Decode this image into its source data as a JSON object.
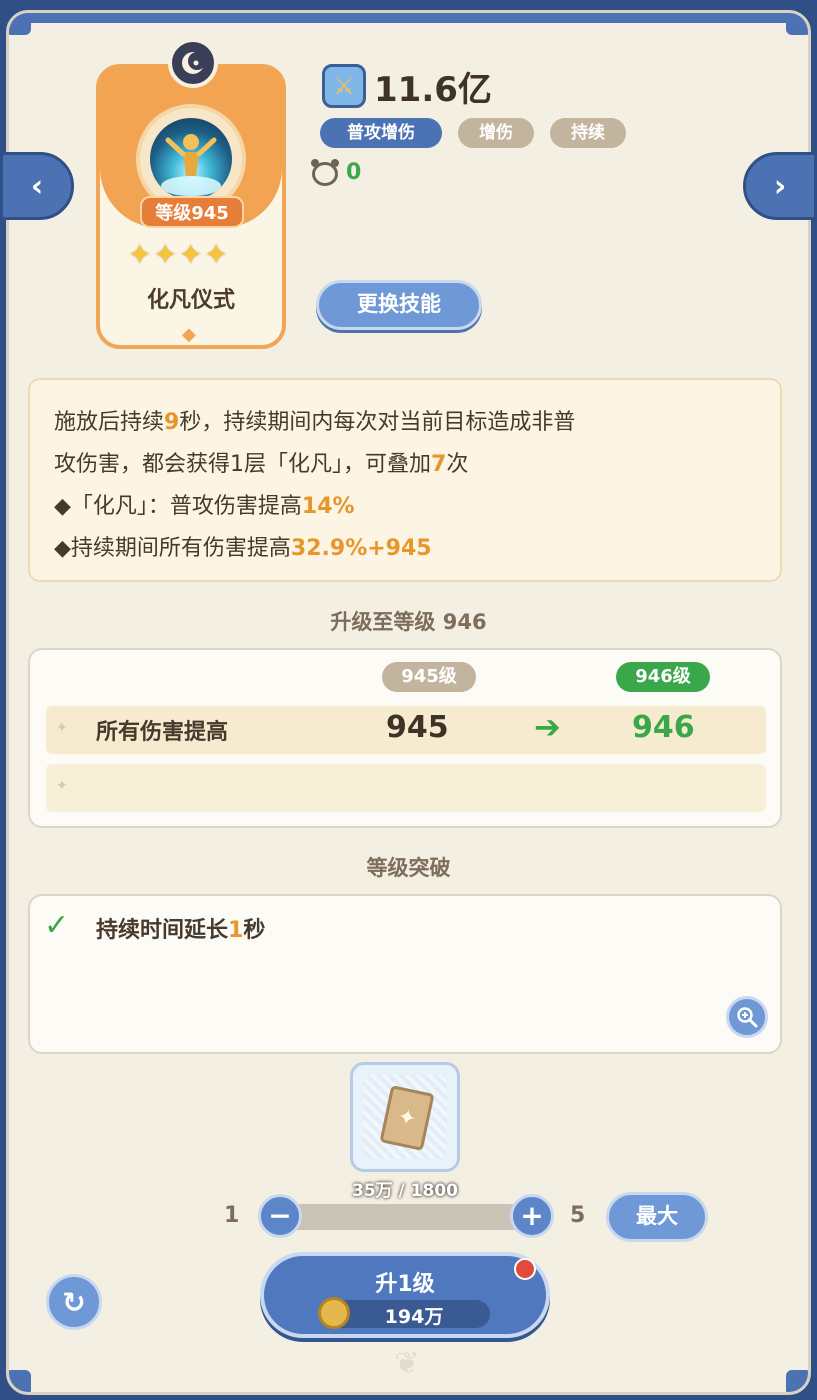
{
  "skill": {
    "level_badge": "等级945",
    "stars": [
      "✦",
      "✦",
      "✦",
      "✦"
    ],
    "name": "化凡仪式"
  },
  "stats": {
    "power": "11.6亿",
    "tags": [
      "普攻增伤",
      "增伤",
      "持续"
    ],
    "cooldown": "0"
  },
  "buttons": {
    "change_skill": "更换技能",
    "max": "最大",
    "upgrade": "升1级"
  },
  "description": {
    "line1_a": "施放后持续",
    "line1_hl": "9",
    "line1_b": "秒，持续期间内每次对当前目标造成非普",
    "line2_a": "攻伤害，都会获得1层「化凡」，可叠加",
    "line2_hl": "7",
    "line2_b": "次",
    "line3_a": "◆「化凡」：普攻伤害提高",
    "line3_hl": "14%",
    "line4_a": "◆持续期间所有伤害提高",
    "line4_hl": "32.9%+945"
  },
  "upgrade": {
    "title": "升级至等级 946",
    "current_label": "945级",
    "next_label": "946级",
    "rows": [
      {
        "label": "所有伤害提高",
        "old": "945",
        "arrow": "➔",
        "new": "946"
      }
    ]
  },
  "breakthrough": {
    "title": "等级突破",
    "text_a": "持续时间延长",
    "text_hl": "1",
    "text_b": "秒"
  },
  "material": {
    "count": "35万 / 1800"
  },
  "stepper": {
    "min": "1",
    "max": "5",
    "minus": "−",
    "plus": "+"
  },
  "cost": "194万",
  "colors": {
    "accent_blue": "#4c72b3",
    "highlight_orange": "#e8962c",
    "green": "#3aa84a",
    "card_orange": "#f3a452"
  }
}
